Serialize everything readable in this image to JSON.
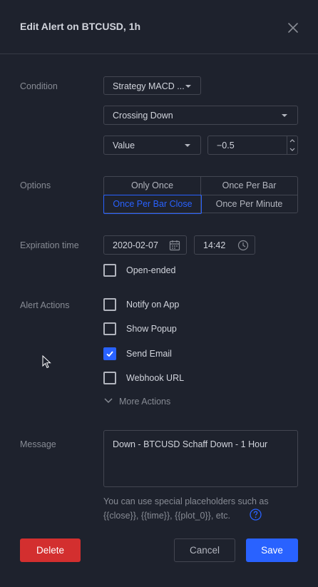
{
  "dialog": {
    "title": "Edit Alert on BTCUSD, 1h"
  },
  "condition": {
    "label": "Condition",
    "source": "Strategy MACD ...",
    "operator": "Crossing Down",
    "value_type": "Value",
    "value": "−0.5"
  },
  "options": {
    "label": "Options",
    "items": [
      "Only Once",
      "Once Per Bar",
      "Once Per Bar Close",
      "Once Per Minute"
    ],
    "selected": "Once Per Bar Close"
  },
  "expiration": {
    "label": "Expiration time",
    "date": "2020-02-07",
    "time": "14:42",
    "open_ended": {
      "label": "Open-ended",
      "checked": false
    }
  },
  "alert_actions": {
    "label": "Alert Actions",
    "items": [
      {
        "label": "Notify on App",
        "checked": false
      },
      {
        "label": "Show Popup",
        "checked": false
      },
      {
        "label": "Send Email",
        "checked": true
      },
      {
        "label": "Webhook URL",
        "checked": false
      }
    ],
    "more_label": "More Actions"
  },
  "message": {
    "label": "Message",
    "text": "Down - BTCUSD Schaff Down - 1 Hour",
    "hint_line1": "You can use special placeholders such as",
    "hint_line2": "{{close}}, {{time}}, {{plot_0}}, etc."
  },
  "buttons": {
    "delete": "Delete",
    "cancel": "Cancel",
    "save": "Save"
  },
  "colors": {
    "background": "#1e222d",
    "accent": "#2962ff",
    "danger": "#d32f2f",
    "border": "#434651"
  }
}
